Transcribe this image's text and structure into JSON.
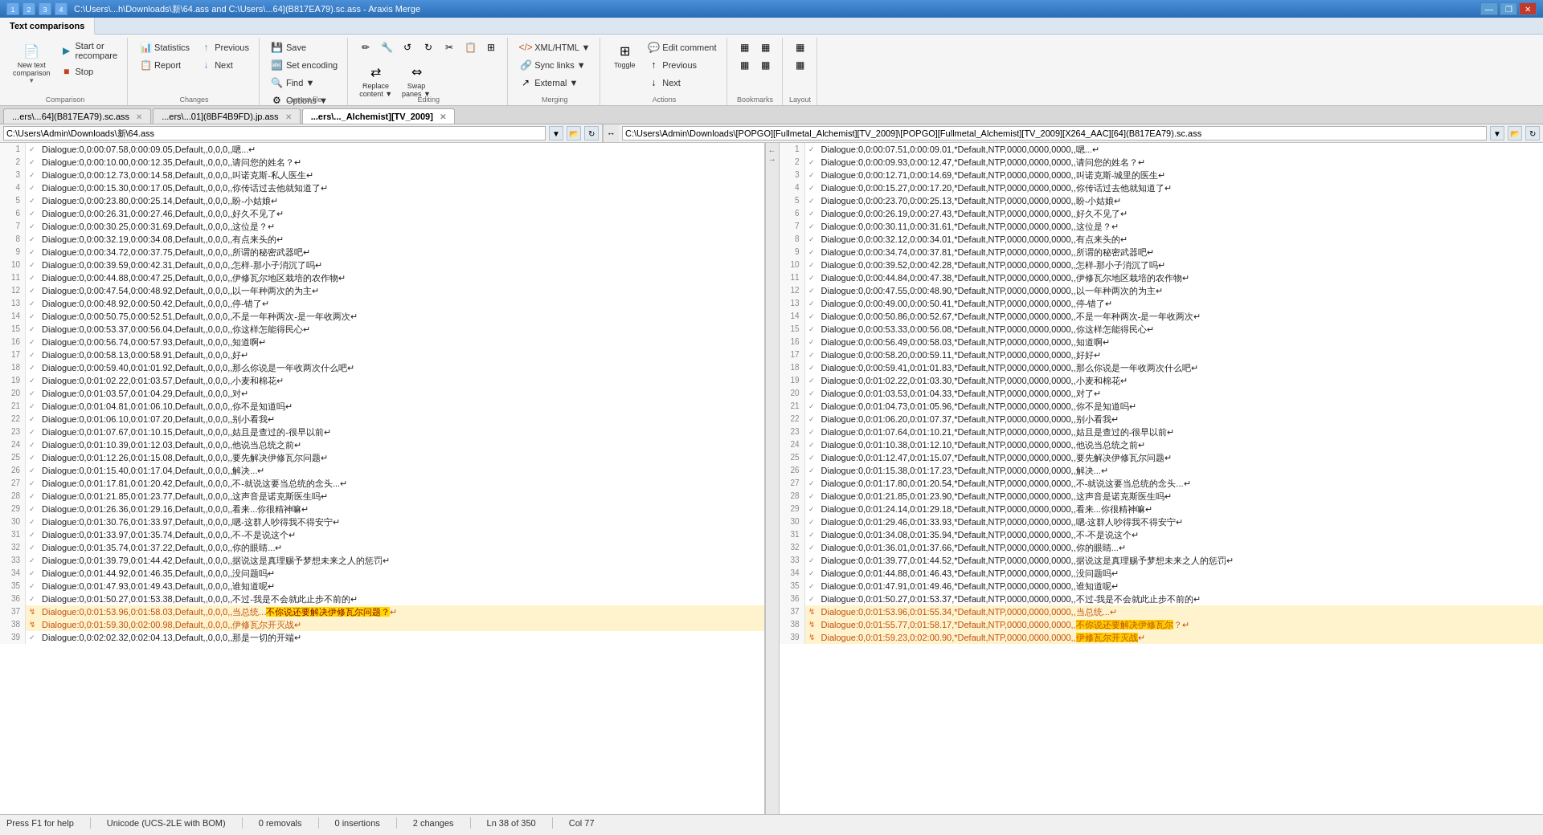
{
  "titlebar": {
    "title": "C:\\Users\\...h\\Downloads\\新\\64.ass and C:\\Users\\...64](B817EA79).sc.ass - Araxis Merge",
    "icons": [
      "1",
      "2",
      "3",
      "4"
    ],
    "winbtns": [
      "—",
      "❐",
      "✕"
    ]
  },
  "ribbon": {
    "tabs": [
      "Text comparisons"
    ],
    "active_tab": "Text comparisons",
    "groups": {
      "comparison": {
        "label": "Comparison",
        "new_comparison": "New text\ncomparison",
        "start_recompare": "Start or\nrecompare",
        "stop": "Stop"
      },
      "changes": {
        "label": "Changes",
        "statistics": "Statistics",
        "previous": "Previous",
        "next": "Next",
        "report": "Report"
      },
      "current_file": {
        "label": "Current file",
        "save": "Save",
        "set_encoding": "Set encoding",
        "find": "Find ▼",
        "options": "Options ▼"
      },
      "editing": {
        "label": "Editing",
        "edit_tools": [
          "✏",
          "🔧",
          "↺",
          "↻",
          "✂",
          "📋",
          "⊞"
        ],
        "replace": "Replace\ncontent ▼",
        "swap": "Swap\npanes ▼"
      },
      "merging": {
        "label": "Merging",
        "xml_html": "XML/HTML ▼",
        "sync": "Sync links ▼",
        "external": "External ▼"
      },
      "actions": {
        "label": "Actions",
        "toggle": "Toggle",
        "edit_comment": "Edit comment",
        "prev_bookmark": "Previous",
        "next_bookmark": "Next"
      },
      "bookmarks": {
        "label": "Bookmarks",
        "btn1": "▦",
        "btn2": "▦",
        "btn3": "▦",
        "btn4": "▦"
      },
      "layout": {
        "label": "Layout",
        "btn1": "▦",
        "btn2": "▦"
      }
    }
  },
  "doc_tabs": [
    {
      "label": "...ers\\...64](B817EA79).sc.ass",
      "active": false
    },
    {
      "label": "...ers\\...01](8BF4B9FD).jp.ass",
      "active": false
    },
    {
      "label": "...ers\\..._Alchemist][TV_2009]",
      "active": true
    }
  ],
  "left_pane": {
    "path": "C:\\Users\\Admin\\Downloads\\新\\64.ass",
    "lines": [
      {
        "num": 1,
        "mark": "✓",
        "changed": false,
        "text": "Dialogue:0,0:00:07.58,0:00:09.05,Default,,0,0,0,,嗯...↵"
      },
      {
        "num": 2,
        "mark": "✓",
        "changed": false,
        "text": "Dialogue:0,0:00:10.00,0:00:12.35,Default,,0,0,0,,请问您的姓名？↵"
      },
      {
        "num": 3,
        "mark": "✓",
        "changed": false,
        "text": "Dialogue:0,0:00:12.73,0:00:14.58,Default,,0,0,0,,叫诺克斯-私人医生↵"
      },
      {
        "num": 4,
        "mark": "✓",
        "changed": false,
        "text": "Dialogue:0,0:00:15.30,0:00:17.05,Default,,0,0,0,,你传话过去他就知道了↵"
      },
      {
        "num": 5,
        "mark": "✓",
        "changed": false,
        "text": "Dialogue:0,0:00:23.80,0:00:25.14,Default,,0,0,0,,盼-小姑娘↵"
      },
      {
        "num": 6,
        "mark": "✓",
        "changed": false,
        "text": "Dialogue:0,0:00:26.31,0:00:27.46,Default,,0,0,0,,好久不见了↵"
      },
      {
        "num": 7,
        "mark": "✓",
        "changed": false,
        "text": "Dialogue:0,0:00:30.25,0:00:31.69,Default,,0,0,0,,这位是？↵"
      },
      {
        "num": 8,
        "mark": "✓",
        "changed": false,
        "text": "Dialogue:0,0:00:32.19,0:00:34.08,Default,,0,0,0,,有点来头的↵"
      },
      {
        "num": 9,
        "mark": "✓",
        "changed": false,
        "text": "Dialogue:0,0:00:34.72,0:00:37.75,Default,,0,0,0,,所谓的秘密武器吧↵"
      },
      {
        "num": 10,
        "mark": "✓",
        "changed": false,
        "text": "Dialogue:0,0:00:39.59,0:00:42.31,Default,,0,0,0,,怎样-那小子消沉了吗↵"
      },
      {
        "num": 11,
        "mark": "✓",
        "changed": false,
        "text": "Dialogue:0,0:00:44.88,0:00:47.25,Default,,0,0,0,,伊修瓦尔地区栽培的农作物↵"
      },
      {
        "num": 12,
        "mark": "✓",
        "changed": false,
        "text": "Dialogue:0,0:00:47.54,0:00:48.92,Default,,0,0,0,,以一年种两次的为主↵"
      },
      {
        "num": 13,
        "mark": "✓",
        "changed": false,
        "text": "Dialogue:0,0:00:48.92,0:00:50.42,Default,,0,0,0,,停-错了↵"
      },
      {
        "num": 14,
        "mark": "✓",
        "changed": false,
        "text": "Dialogue:0,0:00:50.75,0:00:52.51,Default,,0,0,0,,不是一年种两次-是一年收两次↵"
      },
      {
        "num": 15,
        "mark": "✓",
        "changed": false,
        "text": "Dialogue:0,0:00:53.37,0:00:56.04,Default,,0,0,0,,你这样怎能得民心↵"
      },
      {
        "num": 16,
        "mark": "✓",
        "changed": false,
        "text": "Dialogue:0,0:00:56.74,0:00:57.93,Default,,0,0,0,,知道啊↵"
      },
      {
        "num": 17,
        "mark": "✓",
        "changed": false,
        "text": "Dialogue:0,0:00:58.13,0:00:58.91,Default,,0,0,0,,好↵"
      },
      {
        "num": 18,
        "mark": "✓",
        "changed": false,
        "text": "Dialogue:0,0:00:59.40,0:01:01.92,Default,,0,0,0,,那么你说是一年收两次什么吧↵"
      },
      {
        "num": 19,
        "mark": "✓",
        "changed": false,
        "text": "Dialogue:0,0:01:02.22,0:01:03.57,Default,,0,0,0,,小麦和棉花↵"
      },
      {
        "num": 20,
        "mark": "✓",
        "changed": false,
        "text": "Dialogue:0,0:01:03.57,0:01:04.29,Default,,0,0,0,,对↵"
      },
      {
        "num": 21,
        "mark": "✓",
        "changed": false,
        "text": "Dialogue:0,0:01:04.81,0:01:06.10,Default,,0,0,0,,你不是知道吗↵"
      },
      {
        "num": 22,
        "mark": "✓",
        "changed": false,
        "text": "Dialogue:0,0:01:06.10,0:01:07.20,Default,,0,0,0,,别小看我↵"
      },
      {
        "num": 23,
        "mark": "✓",
        "changed": false,
        "text": "Dialogue:0,0:01:07.67,0:01:10.15,Default,,0,0,0,,姑且是查过的-很早以前↵"
      },
      {
        "num": 24,
        "mark": "✓",
        "changed": false,
        "text": "Dialogue:0,0:01:10.39,0:01:12.03,Default,,0,0,0,,他说当总统之前↵"
      },
      {
        "num": 25,
        "mark": "✓",
        "changed": false,
        "text": "Dialogue:0,0:01:12.26,0:01:15.08,Default,,0,0,0,,要先解决伊修瓦尔问题↵"
      },
      {
        "num": 26,
        "mark": "✓",
        "changed": false,
        "text": "Dialogue:0,0:01:15.40,0:01:17.04,Default,,0,0,0,,解决...↵"
      },
      {
        "num": 27,
        "mark": "✓",
        "changed": false,
        "text": "Dialogue:0,0:01:17.81,0:01:20.42,Default,,0,0,0,,不-就说这要当总统的念头...↵"
      },
      {
        "num": 28,
        "mark": "✓",
        "changed": false,
        "text": "Dialogue:0,0:01:21.85,0:01:23.77,Default,,0,0,0,,这声音是诺克斯医生吗↵"
      },
      {
        "num": 29,
        "mark": "✓",
        "changed": false,
        "text": "Dialogue:0,0:01:26.36,0:01:29.16,Default,,0,0,0,,看来...你很精神嘛↵"
      },
      {
        "num": 30,
        "mark": "✓",
        "changed": false,
        "text": "Dialogue:0,0:01:30.76,0:01:33.97,Default,,0,0,0,,嗯-这群人吵得我不得安宁↵"
      },
      {
        "num": 31,
        "mark": "✓",
        "changed": false,
        "text": "Dialogue:0,0:01:33.97,0:01:35.74,Default,,0,0,0,,不-不是说这个↵"
      },
      {
        "num": 32,
        "mark": "✓",
        "changed": false,
        "text": "Dialogue:0,0:01:35.74,0:01:37.22,Default,,0,0,0,,你的眼睛...↵"
      },
      {
        "num": 33,
        "mark": "✓",
        "changed": false,
        "text": "Dialogue:0,0:01:39.79,0:01:44.42,Default,,0,0,0,,据说这是真理赐予梦想未来之人的惩罚↵"
      },
      {
        "num": 34,
        "mark": "✓",
        "changed": false,
        "text": "Dialogue:0,0:01:44.92,0:01:46.35,Default,,0,0,0,,没问题吗↵"
      },
      {
        "num": 35,
        "mark": "✓",
        "changed": false,
        "text": "Dialogue:0,0:01:47.93,0:01:49.43,Default,,0,0,0,,谁知道呢↵"
      },
      {
        "num": 36,
        "mark": "✓",
        "changed": false,
        "text": "Dialogue:0,0:01:50.27,0:01:53.38,Default,,0,0,0,,不过-我是不会就此止步不前的↵"
      },
      {
        "num": 37,
        "mark": "↯",
        "changed": true,
        "text": "Dialogue:0,0:01:53.96,0:01:58.03,Default,,0,0,0,,当总统...不你说还要解决伊修瓦尔问题？↵"
      },
      {
        "num": 38,
        "mark": "↯",
        "changed": true,
        "text": "Dialogue:0,0:01:59.30,0:02:00.98,Default,,0,0,0,,伊修瓦尔开灭战↵"
      },
      {
        "num": 39,
        "mark": "✓",
        "changed": false,
        "text": "Dialogue:0,0:02:02.32,0:02:04.13,Default,,0,0,0,,那是一切的开端↵"
      }
    ]
  },
  "right_pane": {
    "path": "C:\\Users\\Admin\\Downloads\\[POPGO][Fullmetal_Alchemist][TV_2009]\\[POPGO][Fullmetal_Alchemist][TV_2009][X264_AAC][64](B817EA79).sc.ass",
    "lines": [
      {
        "num": 1,
        "mark": "✓",
        "changed": false,
        "text": "Dialogue:0,0:00:07.51,0:00:09.01,*Default,NTP,0000,0000,0000,,嗯...↵"
      },
      {
        "num": 2,
        "mark": "✓",
        "changed": false,
        "text": "Dialogue:0,0:00:09.93,0:00:12.47,*Default,NTP,0000,0000,0000,,请问您的姓名？↵"
      },
      {
        "num": 3,
        "mark": "✓",
        "changed": false,
        "text": "Dialogue:0,0:00:12.71,0:00:14.69,*Default,NTP,0000,0000,0000,,叫诺克斯-城里的医生↵"
      },
      {
        "num": 4,
        "mark": "✓",
        "changed": false,
        "text": "Dialogue:0,0:00:15.27,0:00:17.20,*Default,NTP,0000,0000,0000,,你传话过去他就知道了↵"
      },
      {
        "num": 5,
        "mark": "✓",
        "changed": false,
        "text": "Dialogue:0,0:00:23.70,0:00:25.13,*Default,NTP,0000,0000,0000,,盼-小姑娘↵"
      },
      {
        "num": 6,
        "mark": "✓",
        "changed": false,
        "text": "Dialogue:0,0:00:26.19,0:00:27.43,*Default,NTP,0000,0000,0000,,好久不见了↵"
      },
      {
        "num": 7,
        "mark": "✓",
        "changed": false,
        "text": "Dialogue:0,0:00:30.11,0:00:31.61,*Default,NTP,0000,0000,0000,,这位是？↵"
      },
      {
        "num": 8,
        "mark": "✓",
        "changed": false,
        "text": "Dialogue:0,0:00:32.12,0:00:34.01,*Default,NTP,0000,0000,0000,,有点来头的↵"
      },
      {
        "num": 9,
        "mark": "✓",
        "changed": false,
        "text": "Dialogue:0,0:00:34.74,0:00:37.81,*Default,NTP,0000,0000,0000,,所谓的秘密武器吧↵"
      },
      {
        "num": 10,
        "mark": "✓",
        "changed": false,
        "text": "Dialogue:0,0:00:39.52,0:00:42.28,*Default,NTP,0000,0000,0000,,怎样-那小子消沉了吗↵"
      },
      {
        "num": 11,
        "mark": "✓",
        "changed": false,
        "text": "Dialogue:0,0:00:44.84,0:00:47.38,*Default,NTP,0000,0000,0000,,伊修瓦尔地区栽培的农作物↵"
      },
      {
        "num": 12,
        "mark": "✓",
        "changed": false,
        "text": "Dialogue:0,0:00:47.55,0:00:48.90,*Default,NTP,0000,0000,0000,,以一年种两次的为主↵"
      },
      {
        "num": 13,
        "mark": "✓",
        "changed": false,
        "text": "Dialogue:0,0:00:49.00,0:00:50.41,*Default,NTP,0000,0000,0000,,停-错了↵"
      },
      {
        "num": 14,
        "mark": "✓",
        "changed": false,
        "text": "Dialogue:0,0:00:50.86,0:00:52.67,*Default,NTP,0000,0000,0000,,不是一年种两次-是一年收两次↵"
      },
      {
        "num": 15,
        "mark": "✓",
        "changed": false,
        "text": "Dialogue:0,0:00:53.33,0:00:56.08,*Default,NTP,0000,0000,0000,,你这样怎能得民心↵"
      },
      {
        "num": 16,
        "mark": "✓",
        "changed": false,
        "text": "Dialogue:0,0:00:56.49,0:00:58.03,*Default,NTP,0000,0000,0000,,知道啊↵"
      },
      {
        "num": 17,
        "mark": "✓",
        "changed": false,
        "text": "Dialogue:0,0:00:58.20,0:00:59.11,*Default,NTP,0000,0000,0000,,好好↵"
      },
      {
        "num": 18,
        "mark": "✓",
        "changed": false,
        "text": "Dialogue:0,0:00:59.41,0:01:01.83,*Default,NTP,0000,0000,0000,,那么你说是一年收两次什么吧↵"
      },
      {
        "num": 19,
        "mark": "✓",
        "changed": false,
        "text": "Dialogue:0,0:01:02.22,0:01:03.30,*Default,NTP,0000,0000,0000,,小麦和棉花↵"
      },
      {
        "num": 20,
        "mark": "✓",
        "changed": false,
        "text": "Dialogue:0,0:01:03.53,0:01:04.33,*Default,NTP,0000,0000,0000,,对了↵"
      },
      {
        "num": 21,
        "mark": "✓",
        "changed": false,
        "text": "Dialogue:0,0:01:04.73,0:01:05.96,*Default,NTP,0000,0000,0000,,你不是知道吗↵"
      },
      {
        "num": 22,
        "mark": "✓",
        "changed": false,
        "text": "Dialogue:0,0:01:06.20,0:01:07.37,*Default,NTP,0000,0000,0000,,别小看我↵"
      },
      {
        "num": 23,
        "mark": "✓",
        "changed": false,
        "text": "Dialogue:0,0:01:07.64,0:01:10.21,*Default,NTP,0000,0000,0000,,姑且是查过的-很早以前↵"
      },
      {
        "num": 24,
        "mark": "✓",
        "changed": false,
        "text": "Dialogue:0,0:01:10.38,0:01:12.10,*Default,NTP,0000,0000,0000,,他说当总统之前↵"
      },
      {
        "num": 25,
        "mark": "✓",
        "changed": false,
        "text": "Dialogue:0,0:01:12.47,0:01:15.07,*Default,NTP,0000,0000,0000,,要先解决伊修瓦尔问题↵"
      },
      {
        "num": 26,
        "mark": "✓",
        "changed": false,
        "text": "Dialogue:0,0:01:15.38,0:01:17.23,*Default,NTP,0000,0000,0000,,解决...↵"
      },
      {
        "num": 27,
        "mark": "✓",
        "changed": false,
        "text": "Dialogue:0,0:01:17.80,0:01:20.54,*Default,NTP,0000,0000,0000,,不-就说这要当总统的念头...↵"
      },
      {
        "num": 28,
        "mark": "✓",
        "changed": false,
        "text": "Dialogue:0,0:01:21.85,0:01:23.90,*Default,NTP,0000,0000,0000,,这声音是诺克斯医生吗↵"
      },
      {
        "num": 29,
        "mark": "✓",
        "changed": false,
        "text": "Dialogue:0,0:01:24.14,0:01:29.18,*Default,NTP,0000,0000,0000,,看来...你很精神嘛↵"
      },
      {
        "num": 30,
        "mark": "✓",
        "changed": false,
        "text": "Dialogue:0,0:01:29.46,0:01:33.93,*Default,NTP,0000,0000,0000,,嗯-这群人吵得我不得安宁↵"
      },
      {
        "num": 31,
        "mark": "✓",
        "changed": false,
        "text": "Dialogue:0,0:01:34.08,0:01:35.94,*Default,NTP,0000,0000,0000,,不-不是说这个↵"
      },
      {
        "num": 32,
        "mark": "✓",
        "changed": false,
        "text": "Dialogue:0,0:01:36.01,0:01:37.66,*Default,NTP,0000,0000,0000,,你的眼睛...↵"
      },
      {
        "num": 33,
        "mark": "✓",
        "changed": false,
        "text": "Dialogue:0,0:01:39.77,0:01:44.52,*Default,NTP,0000,0000,0000,,据说这是真理赐予梦想未来之人的惩罚↵"
      },
      {
        "num": 34,
        "mark": "✓",
        "changed": false,
        "text": "Dialogue:0,0:01:44.88,0:01:46.43,*Default,NTP,0000,0000,0000,,没问题吗↵"
      },
      {
        "num": 35,
        "mark": "✓",
        "changed": false,
        "text": "Dialogue:0,0:01:47.91,0:01:49.46,*Default,NTP,0000,0000,0000,,谁知道呢↵"
      },
      {
        "num": 36,
        "mark": "✓",
        "changed": false,
        "text": "Dialogue:0,0:01:50.27,0:01:53.37,*Default,NTP,0000,0000,0000,,不过-我是不会就此止步不前的↵"
      },
      {
        "num": 37,
        "mark": "↯",
        "changed": true,
        "text": "Dialogue:0,0:01:53.96,0:01:55.34,*Default,NTP,0000,0000,0000,,当总统...↵"
      },
      {
        "num": 38,
        "mark": "↯",
        "changed": true,
        "text": "Dialogue:0,0:01:55.77,0:01:58.17,*Default,NTP,0000,0000,0000,,不你说还要解决伊修瓦尔？↵"
      },
      {
        "num": 39,
        "mark": "↯",
        "changed": true,
        "text": "Dialogue:0,0:01:59.23,0:02:00.90,*Default,NTP,0000,0000,0000,,伊修瓦尔开灭战↵"
      }
    ]
  },
  "statusbar": {
    "help": "Press F1 for help",
    "encoding": "Unicode (UCS-2LE with BOM)",
    "removals": "0 removals",
    "insertions": "0 insertions",
    "changes": "2 changes",
    "ln": "Ln 38 of 350",
    "col": "Col 77"
  }
}
